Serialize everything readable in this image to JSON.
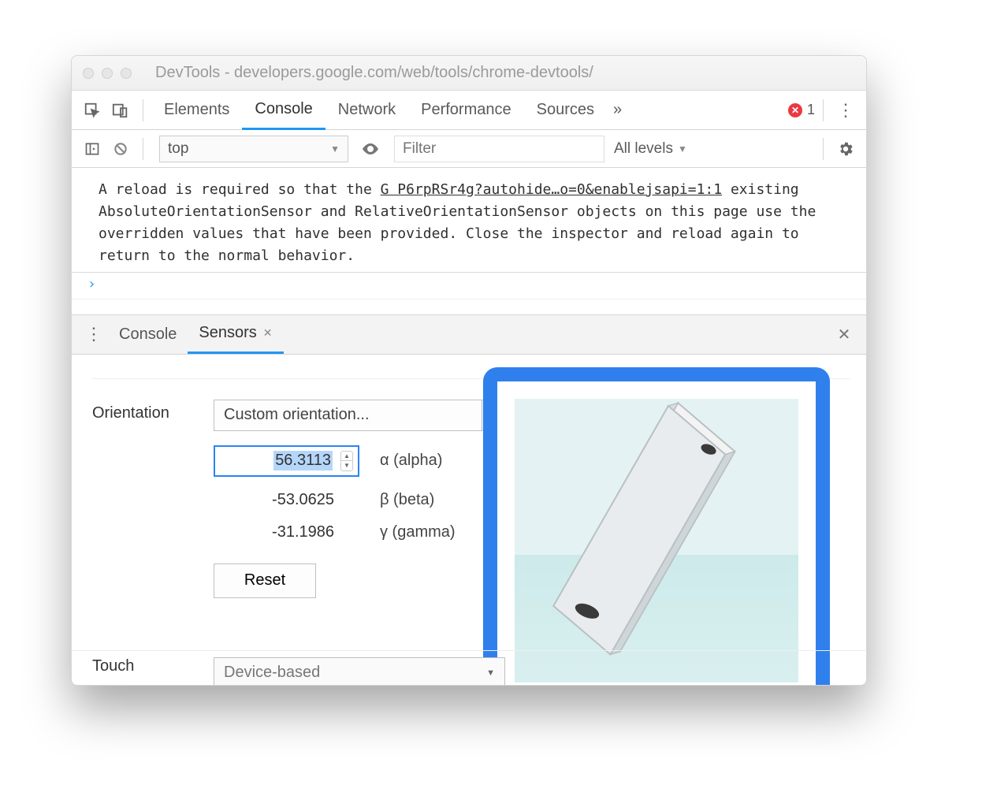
{
  "window": {
    "title": "DevTools - developers.google.com/web/tools/chrome-devtools/"
  },
  "tabs": {
    "items": [
      "Elements",
      "Console",
      "Network",
      "Performance",
      "Sources"
    ],
    "active": "Console",
    "overflow": "»",
    "errors": "1"
  },
  "filter": {
    "context": "top",
    "filter_placeholder": "Filter",
    "levels": "All levels"
  },
  "console": {
    "msg_prefix": "A reload is required so that the ",
    "msg_src": "G P6rpRSr4g?autohide…o=0&enablejsapi=1:1",
    "msg_rest": "existing AbsoluteOrientationSensor and RelativeOrientationSensor objects on this page use the overridden values that have been provided. Close the inspector and reload again to return to the normal behavior.",
    "prompt": "›"
  },
  "drawer": {
    "tabs": [
      "Console",
      "Sensors"
    ],
    "active": "Sensors"
  },
  "sensors": {
    "orientation_label": "Orientation",
    "preset": "Custom orientation...",
    "alpha": {
      "value": "56.3113",
      "label": "α (alpha)"
    },
    "beta": {
      "value": "-53.0625",
      "label": "β (beta)"
    },
    "gamma": {
      "value": "-31.1986",
      "label": "γ (gamma)"
    },
    "reset": "Reset",
    "touch_label": "Touch",
    "touch_value": "Device-based"
  }
}
